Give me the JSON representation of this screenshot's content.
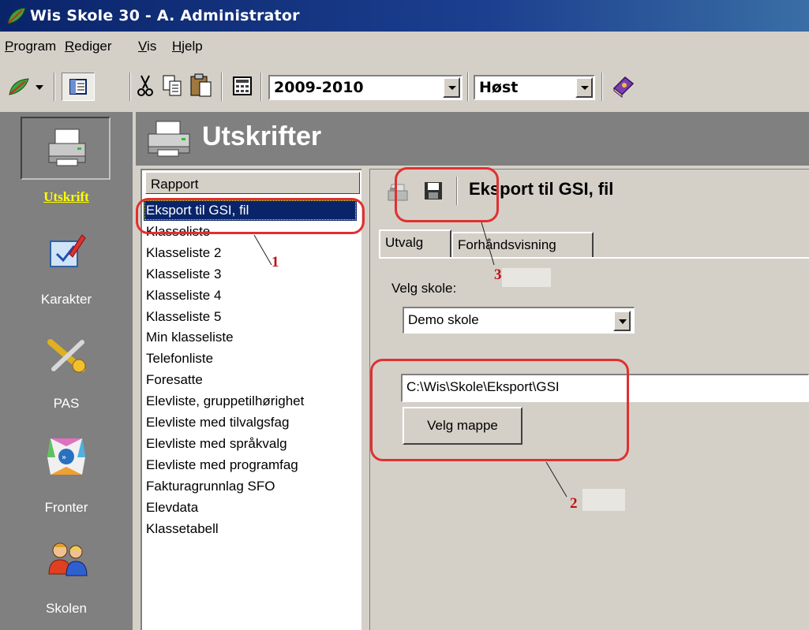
{
  "window": {
    "title": "Wis Skole 30  -  A. Administrator"
  },
  "menu": [
    "Program",
    "Rediger",
    "Vis",
    "Hjelp"
  ],
  "toolbar": {
    "year": "2009-2010",
    "term": "Høst"
  },
  "sidebar": [
    {
      "label": "Utskrift",
      "icon": "printer-icon",
      "active": true
    },
    {
      "label": "Karakter",
      "icon": "grade-pencil-icon",
      "active": false
    },
    {
      "label": "PAS",
      "icon": "pas-tools-icon",
      "active": false
    },
    {
      "label": "Fronter",
      "icon": "fronter-icon",
      "active": false
    },
    {
      "label": "Skolen",
      "icon": "people-icon",
      "active": false
    }
  ],
  "header": {
    "title": "Utskrifter"
  },
  "report_list": {
    "header": "Rapport",
    "items": [
      "Eksport til GSI, fil",
      "Klasseliste",
      "Klasseliste 2",
      "Klasseliste 3",
      "Klasseliste 4",
      "Klasseliste 5",
      "Min klasseliste",
      "Telefonliste",
      "Foresatte",
      "Elevliste, gruppetilhørighet",
      "Elevliste med tilvalgsfag",
      "Elevliste med språkvalg",
      "Elevliste med programfag",
      "Fakturagrunnlag SFO",
      "Elevdata",
      "Klassetabell"
    ],
    "selected_index": 0
  },
  "detail": {
    "title": "Eksport til GSI, fil",
    "tabs": [
      "Utvalg",
      "Forhåndsvisning"
    ],
    "school_label": "Velg skole:",
    "school_value": "Demo skole",
    "path_value": "C:\\Wis\\Skole\\Eksport\\GSI",
    "folder_button": "Velg mappe"
  },
  "annotations": [
    "1",
    "2",
    "3"
  ]
}
